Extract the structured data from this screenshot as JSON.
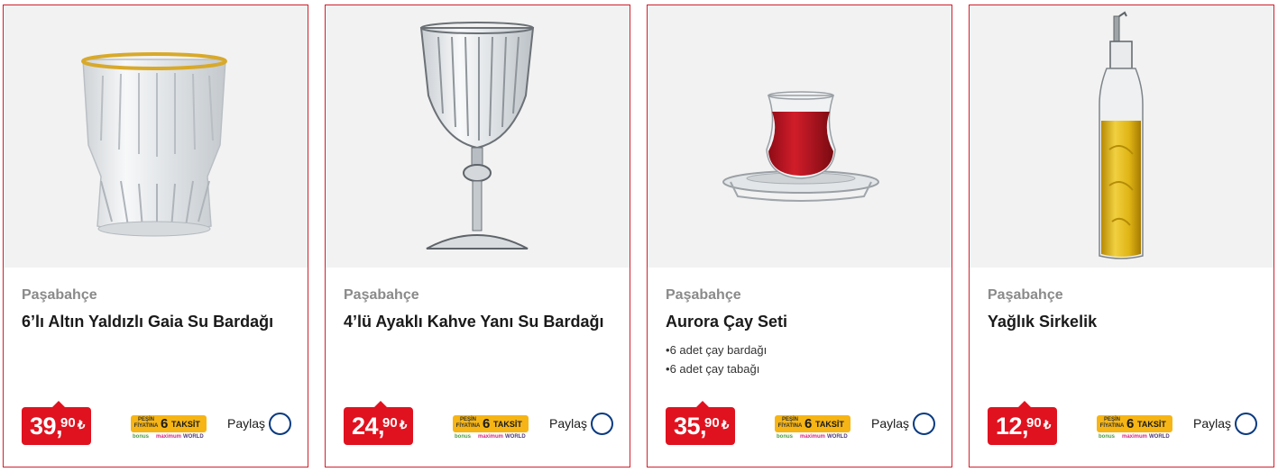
{
  "products": [
    {
      "brand": "Paşabahçe",
      "title": "6’lı Altın Yaldızlı Gaia Su Bardağı",
      "features": [],
      "price_int": "39,",
      "price_dec": "90",
      "currency": "₺",
      "image_icon": "gold-rim-tumbler-glass-image",
      "show_taksit": true
    },
    {
      "brand": "Paşabahçe",
      "title": "4’lü Ayaklı Kahve Yanı Su Bardağı",
      "features": [],
      "price_int": "24,",
      "price_dec": "90",
      "currency": "₺",
      "image_icon": "stemmed-glass-image",
      "show_taksit": true
    },
    {
      "brand": "Paşabahçe",
      "title": "Aurora Çay Seti",
      "features": [
        "6 adet çay bardağı",
        "6 adet çay tabağı"
      ],
      "price_int": "35,",
      "price_dec": "90",
      "currency": "₺",
      "image_icon": "tea-glass-with-saucer-image",
      "show_taksit": true
    },
    {
      "brand": "Paşabahçe",
      "title": "Yağlık Sirkelik",
      "features": [],
      "price_int": "12,",
      "price_dec": "90",
      "currency": "₺",
      "image_icon": "oil-bottle-image",
      "show_taksit": true
    }
  ],
  "taksit_badge": {
    "pesin_label": "PEŞİN FİYATINA",
    "count": "6",
    "word": "TAKSİT",
    "card_logos": [
      "bonus",
      "maximum",
      "WORLD"
    ]
  },
  "share_label": "Paylaş",
  "colors": {
    "card_border": "#d0212e",
    "price_bg": "#e0121f",
    "taksit_bg": "#f6b515",
    "share_circle": "#0a3a80"
  }
}
